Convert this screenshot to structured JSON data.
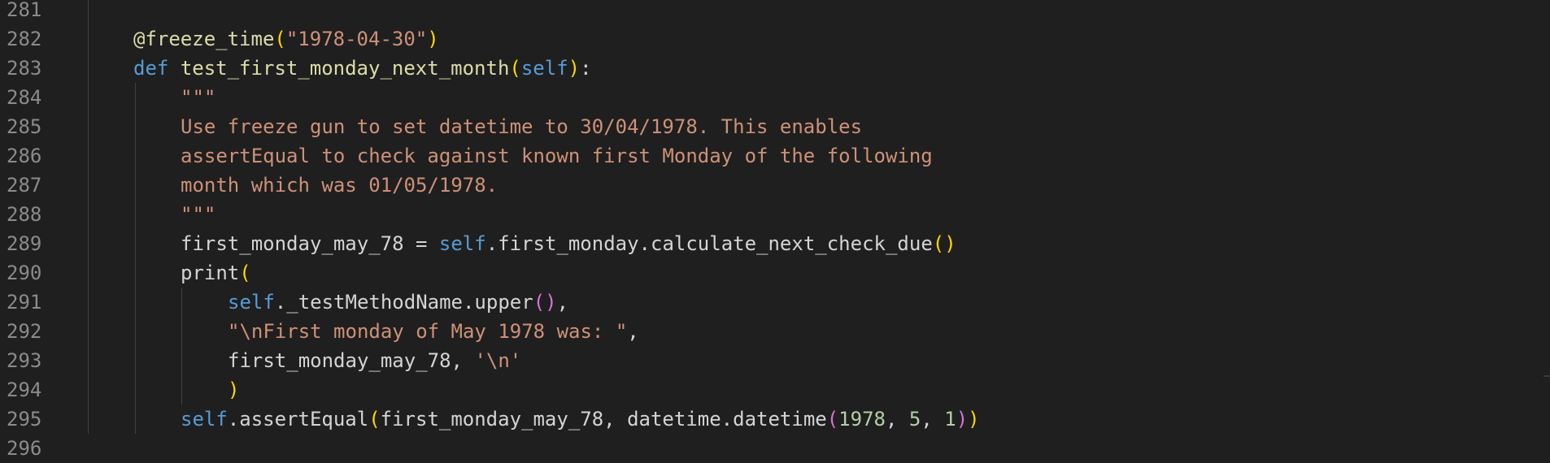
{
  "editor": {
    "line_numbers": [
      "281",
      "282",
      "283",
      "284",
      "285",
      "286",
      "287",
      "288",
      "289",
      "290",
      "291",
      "292",
      "293",
      "294",
      "295",
      "296"
    ],
    "lines": {
      "l282": {
        "decorator": "@freeze_time",
        "open": "(",
        "arg": "\"1978-04-30\"",
        "close": ")"
      },
      "l283": {
        "keyword": "def",
        "name": "test_first_monday_next_month",
        "open": "(",
        "param": "self",
        "close": ")",
        "colon": ":"
      },
      "l284": {
        "text": "\"\"\""
      },
      "l285": {
        "text": "Use freeze gun to set datetime to 30/04/1978. This enables"
      },
      "l286": {
        "text": "assertEqual to check against known first Monday of the following"
      },
      "l287": {
        "text": "month which was 01/05/1978."
      },
      "l288": {
        "text": "\"\"\""
      },
      "l289": {
        "var": "first_monday_may_78",
        "op": " = ",
        "self": "self",
        "rest": ".first_monday.calculate_next_check_due",
        "open": "(",
        "close": ")"
      },
      "l290": {
        "call": "print",
        "open": "("
      },
      "l291": {
        "self": "self",
        "rest": "._testMethodName.upper",
        "open": "(",
        "close": ")",
        "comma": ","
      },
      "l292": {
        "str": "\"\\nFirst monday of May 1978 was: \"",
        "comma": ","
      },
      "l293": {
        "var": "first_monday_may_78",
        "sep": ", ",
        "str": "'\\n'"
      },
      "l294": {
        "close": ")"
      },
      "l295": {
        "self": "self",
        "method": ".assertEqual",
        "open": "(",
        "arg1": "first_monday_may_78, datetime.datetime",
        "open2": "(",
        "n1": "1978",
        "sep1": ", ",
        "n2": "5",
        "sep2": ", ",
        "n3": "1",
        "close2": ")",
        "close": ")"
      }
    }
  }
}
